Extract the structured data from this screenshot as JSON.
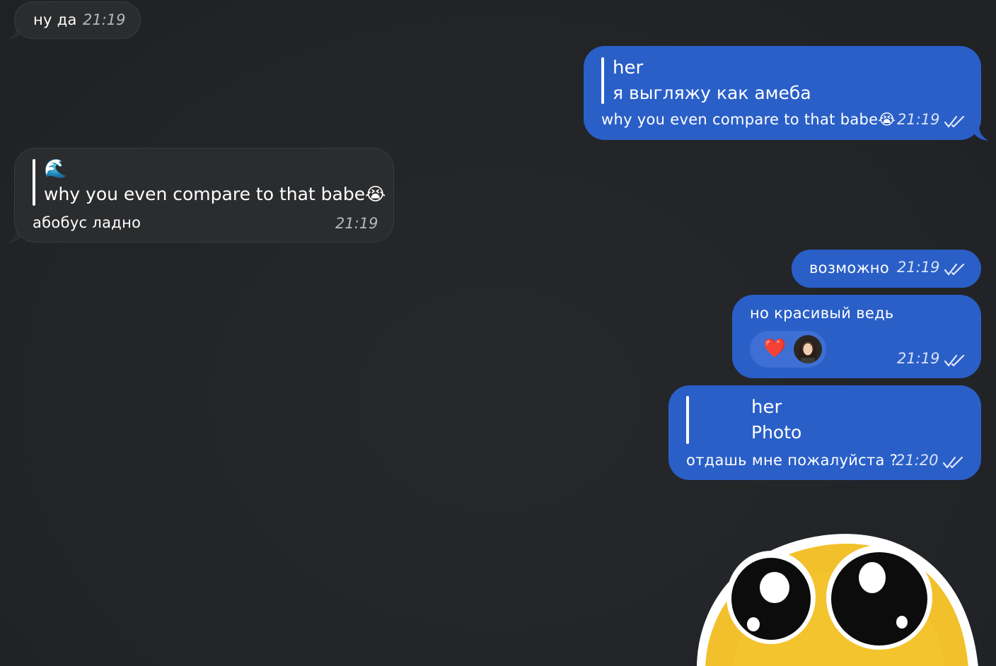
{
  "colors": {
    "background": "#232528",
    "incoming_bubble": "#2b2c2e",
    "outgoing_bubble": "#2a5fc8",
    "reaction_pill": "#3e6fd4"
  },
  "messages": [
    {
      "text": "ну да",
      "time": "21:19"
    },
    {
      "reply_name": "her",
      "reply_text": "я выгляжу как амеба",
      "text": "why you even compare to that babe",
      "emoji": "😭",
      "time": "21:19"
    },
    {
      "reply_name": "🌊",
      "reply_text": "why you even compare to that babe",
      "reply_emoji": "😭",
      "text": "абобус ладно",
      "time": "21:19"
    },
    {
      "text": "возможно",
      "time": "21:19"
    },
    {
      "text": "но красивый ведь",
      "reaction": "❤️",
      "time": "21:19"
    },
    {
      "reply_name": "her",
      "reply_text": "Photo",
      "text": "отдашь мне пожалуйста ?",
      "time": "21:20"
    }
  ],
  "sticker": {
    "icon": "pleading-face-sticker"
  }
}
